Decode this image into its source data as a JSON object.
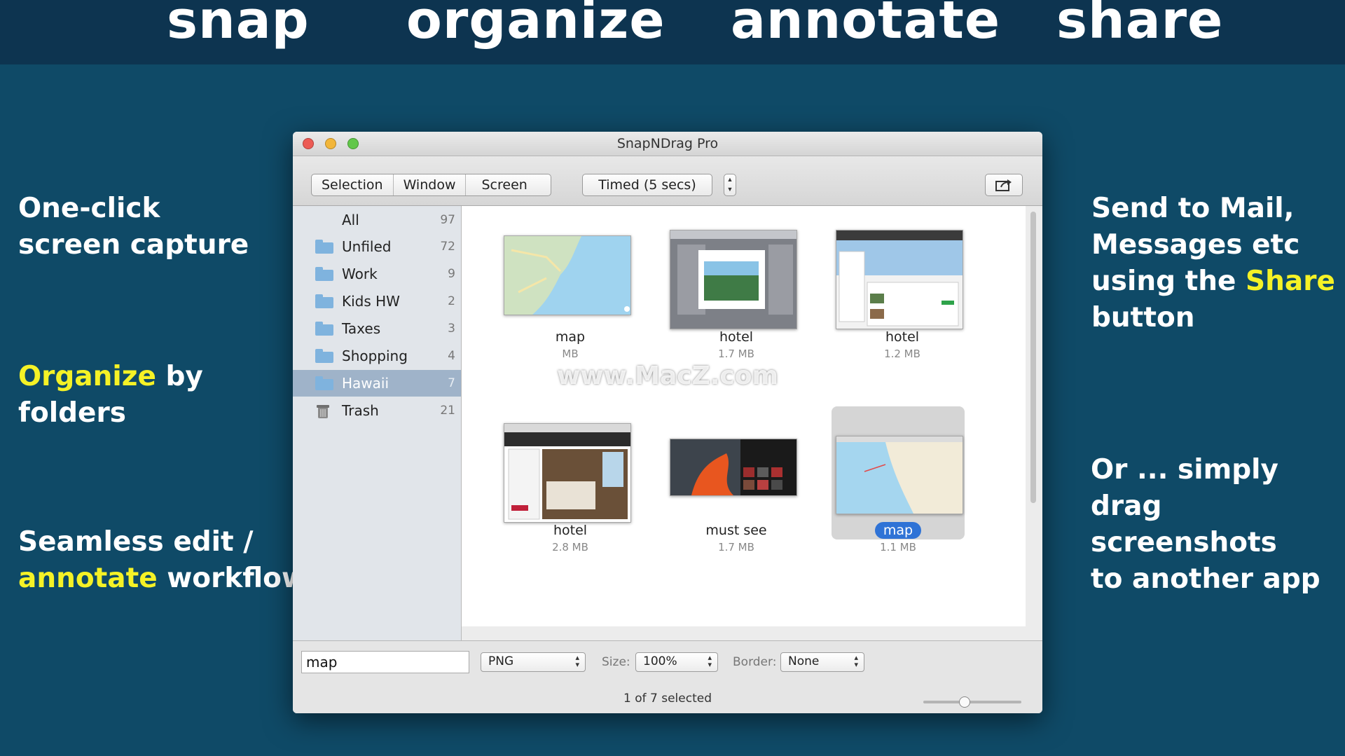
{
  "header": {
    "words": [
      "snap",
      "organize",
      "annotate",
      "share"
    ]
  },
  "left_panel": {
    "capture": [
      "One-click",
      "screen capture"
    ],
    "organize": {
      "highlight": "Organize",
      "rest1": " by",
      "rest2": "folders"
    },
    "edit": {
      "line1": "Seamless edit /",
      "highlight": "annotate",
      "rest": " workflow"
    }
  },
  "right_panel": {
    "share": {
      "line1": "Send to Mail,",
      "line2": "Messages etc",
      "line3_pre": "using the ",
      "highlight": "Share",
      "line4": "button"
    },
    "drag": [
      "Or ... simply",
      "drag screenshots",
      "to another app"
    ]
  },
  "window": {
    "title": "SnapNDrag Pro",
    "capture_modes": [
      "Selection",
      "Window",
      "Screen"
    ],
    "timed_label": "Timed (5 secs)",
    "share_icon": "share-icon"
  },
  "sidebar": {
    "items": [
      {
        "label": "All",
        "count": "97",
        "icon": "none"
      },
      {
        "label": "Unfiled",
        "count": "72",
        "icon": "folder-icon"
      },
      {
        "label": "Work",
        "count": "9",
        "icon": "folder-icon"
      },
      {
        "label": "Kids HW",
        "count": "2",
        "icon": "folder-icon"
      },
      {
        "label": "Taxes",
        "count": "3",
        "icon": "folder-icon"
      },
      {
        "label": "Shopping",
        "count": "4",
        "icon": "folder-icon"
      },
      {
        "label": "Hawaii",
        "count": "7",
        "icon": "folder-icon",
        "selected": true
      },
      {
        "label": "Trash",
        "count": "21",
        "icon": "trash-icon"
      }
    ]
  },
  "thumbnails": [
    {
      "name": "map",
      "size": "MB"
    },
    {
      "name": "hotel",
      "size": "1.7 MB"
    },
    {
      "name": "hotel",
      "size": "1.2 MB"
    },
    {
      "name": "hotel",
      "size": "2.8 MB"
    },
    {
      "name": "must see",
      "size": "1.7 MB"
    },
    {
      "name": "map",
      "size": "1.1 MB",
      "selected": true
    }
  ],
  "bottom": {
    "filename": "map",
    "format": "PNG",
    "size_label": "Size:",
    "size_value": "100%",
    "border_label": "Border:",
    "border_value": "None",
    "status": "1 of 7 selected",
    "zoom_fraction": 0.42
  },
  "watermark": "www.MacZ.com",
  "colors": {
    "background": "#0f4a67",
    "header_bar": "#0d3450",
    "highlight": "#f5f226",
    "selection_blue": "#2f73d6"
  }
}
